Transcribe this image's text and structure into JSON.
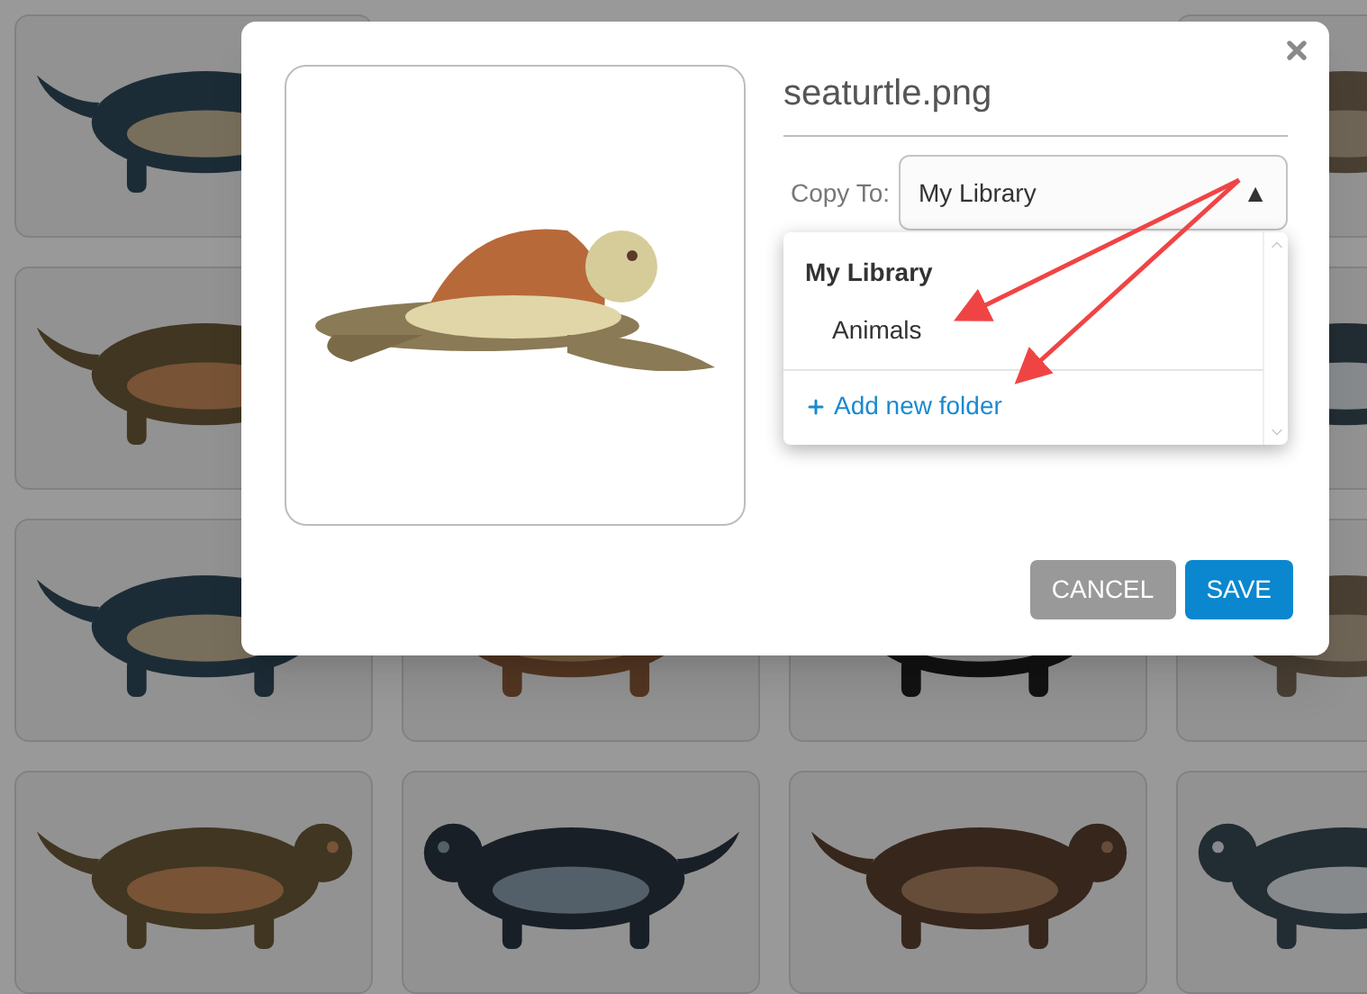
{
  "background_tiles": [
    {
      "kind": "picture"
    },
    {
      "kind": "covered"
    },
    {
      "kind": "covered"
    },
    {
      "kind": "picture"
    },
    {
      "kind": "picture"
    },
    {
      "kind": "covered"
    },
    {
      "kind": "covered"
    },
    {
      "kind": "picture"
    },
    {
      "kind": "picture"
    },
    {
      "kind": "picture"
    },
    {
      "kind": "picture"
    },
    {
      "kind": "picture"
    },
    {
      "kind": "picture"
    },
    {
      "kind": "picture"
    },
    {
      "kind": "picture"
    },
    {
      "kind": "picture"
    }
  ],
  "dialog": {
    "preview": {
      "kind": "picture"
    },
    "file_name": "seaturtle.png",
    "copy_to": {
      "label": "Copy To:",
      "value": "My Library",
      "arrow": "▲",
      "expanded": true
    },
    "folders": [
      {
        "label": "My Library",
        "kind": "root"
      },
      {
        "label": "Animals",
        "kind": "folder"
      }
    ],
    "add_folder": "Add new folder",
    "buttons": [
      {
        "label": "CANCEL",
        "kind": "secondary"
      },
      {
        "label": "SAVE",
        "kind": "primary"
      }
    ]
  }
}
